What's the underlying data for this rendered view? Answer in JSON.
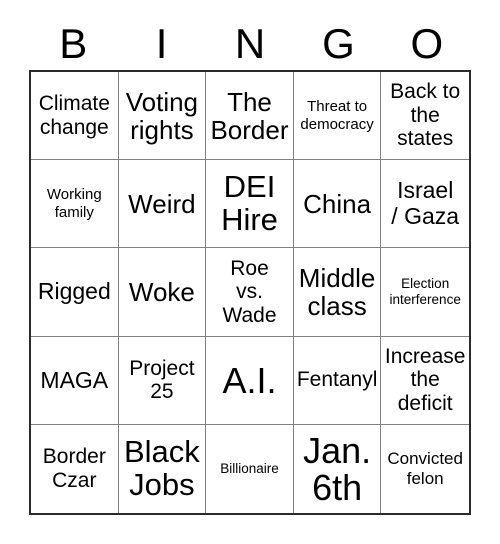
{
  "card": {
    "header_letters": [
      "B",
      "I",
      "N",
      "G",
      "O"
    ],
    "colors": {
      "background": "#ffffff",
      "text": "#000000",
      "grid_line": "#808080",
      "outer_border": "#2b2b2b"
    },
    "rows": [
      [
        {
          "text": "Climate\nchange",
          "size": "sz-m"
        },
        {
          "text": "Voting\nrights",
          "size": "sz-l"
        },
        {
          "text": "The\nBorder",
          "size": "sz-l"
        },
        {
          "text": "Threat to\ndemocracy",
          "size": "sz-s"
        },
        {
          "text": "Back to\nthe\nstates",
          "size": "sz-m"
        }
      ],
      [
        {
          "text": "Working\nfamily",
          "size": "sz-s"
        },
        {
          "text": "Weird",
          "size": "sz-l"
        },
        {
          "text": "DEI\nHire",
          "size": "sz-xl"
        },
        {
          "text": "China",
          "size": "sz-l"
        },
        {
          "text": "Israel\n/ Gaza",
          "size": "sz-ml"
        }
      ],
      [
        {
          "text": "Rigged",
          "size": "sz-ml"
        },
        {
          "text": "Woke",
          "size": "sz-l"
        },
        {
          "text": "Roe\nvs.\nWade",
          "size": "sz-m"
        },
        {
          "text": "Middle\nclass",
          "size": "sz-l"
        },
        {
          "text": "Election\ninterference",
          "size": "sz-xs"
        }
      ],
      [
        {
          "text": "MAGA",
          "size": "sz-ml"
        },
        {
          "text": "Project\n25",
          "size": "sz-m"
        },
        {
          "text": "A.I.",
          "size": "sz-xxl"
        },
        {
          "text": "Fentanyl",
          "size": "sz-m"
        },
        {
          "text": "Increase\nthe\ndeficit",
          "size": "sz-m"
        }
      ],
      [
        {
          "text": "Border\nCzar",
          "size": "sz-m"
        },
        {
          "text": "Black\nJobs",
          "size": "sz-xl"
        },
        {
          "text": "Billionaire",
          "size": "sz-xs"
        },
        {
          "text": "Jan.\n6th",
          "size": "sz-xxl"
        },
        {
          "text": "Convicted\nfelon",
          "size": "sz-sm"
        }
      ]
    ]
  }
}
